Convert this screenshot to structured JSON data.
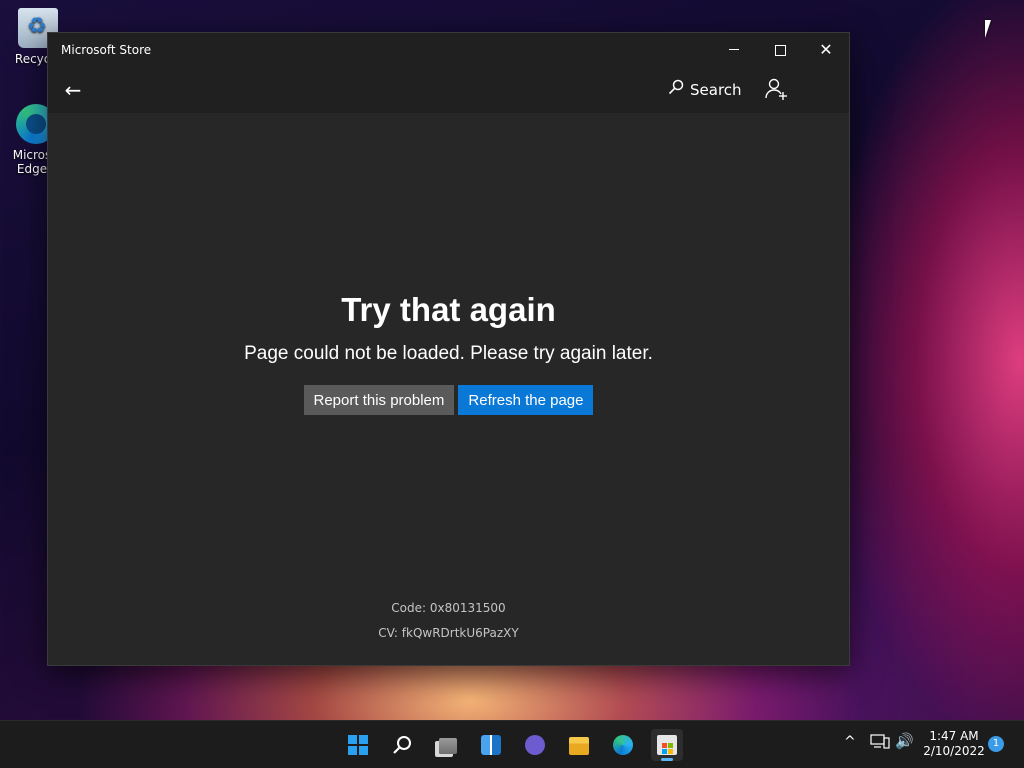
{
  "desktop": {
    "icons": [
      {
        "label": "Recycle"
      },
      {
        "label": "Micros Edge"
      }
    ]
  },
  "window": {
    "title": "Microsoft Store",
    "controls": {
      "minimize": "minimize",
      "maximize": "maximize",
      "close": "✕"
    }
  },
  "navbar": {
    "back_icon": "←",
    "search_label": "Search",
    "search_icon": "⚲"
  },
  "error": {
    "title": "Try that again",
    "message": "Page could not be loaded. Please try again later.",
    "report_label": "Report this problem",
    "refresh_label": "Refresh the page",
    "code": "Code: 0x80131500",
    "cv": "CV: fkQwRDrtkU6PazXY"
  },
  "colors": {
    "accent": "#0a78d7",
    "window_bg": "#272727",
    "titlebar_bg": "#202020",
    "secondary_button": "#5a5a5a"
  },
  "taskbar": {
    "icons": [
      "start-icon",
      "search-icon",
      "task-view-icon",
      "widgets-icon",
      "chat-icon",
      "file-explorer-icon",
      "edge-icon",
      "store-icon"
    ],
    "tray": {
      "chevron": "^",
      "volume": "🔊"
    },
    "clock": {
      "time": "1:47 AM",
      "date": "2/10/2022"
    },
    "notification_count": "1"
  }
}
